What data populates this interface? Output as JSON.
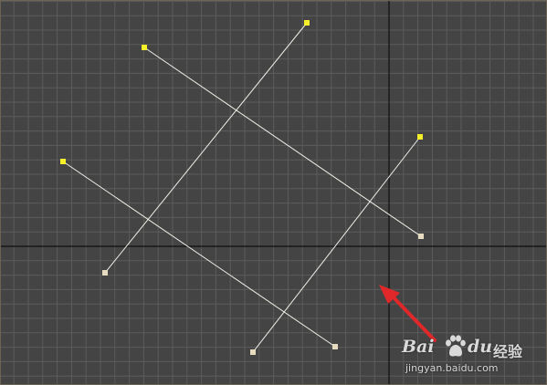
{
  "viewport": {
    "background": "#444444",
    "grid_color": "#5c5c5c",
    "axis_color": "#0f0f0f",
    "border_color": "#6b6455"
  },
  "shapes": {
    "line_color": "#f0f0e8",
    "selected_vertex_color": "#f5f02a",
    "vertex_color": "#e8dcc0"
  },
  "annotation": {
    "arrow_color": "#e0282a"
  },
  "watermark": {
    "brand_left": "Bai",
    "brand_right": "du",
    "brand_cn": "经验",
    "url": "jingyan.baidu.com",
    "paw_icon": "baidu-paw-icon"
  }
}
